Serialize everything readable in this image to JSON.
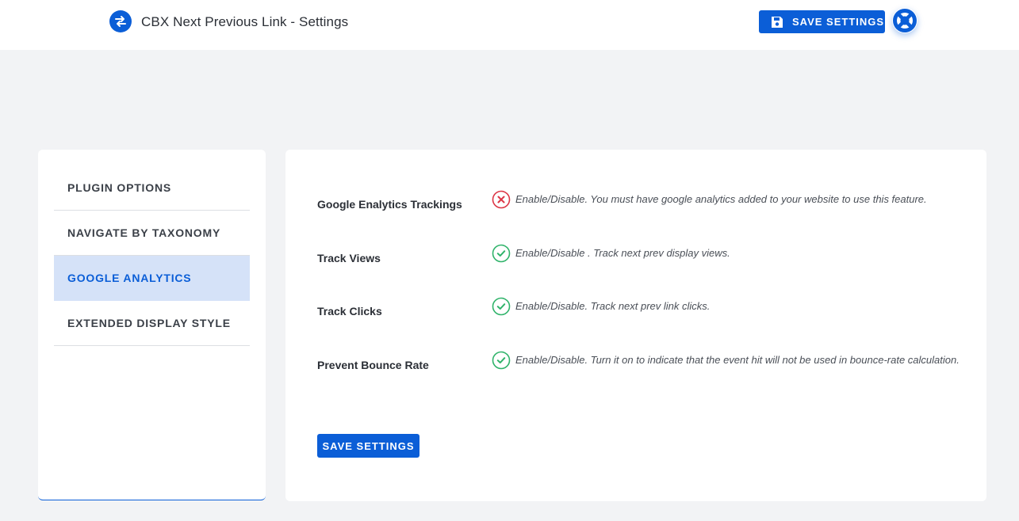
{
  "header": {
    "title": "CBX Next Previous Link - Settings",
    "save_label": "SAVE SETTINGS",
    "logo_icon": "swap-arrows-icon",
    "help_icon": "lifebuoy-icon"
  },
  "sidebar": {
    "items": [
      {
        "label": "PLUGIN OPTIONS",
        "active": false
      },
      {
        "label": "NAVIGATE BY TAXONOMY",
        "active": false
      },
      {
        "label": "GOOGLE ANALYTICS",
        "active": true
      },
      {
        "label": "EXTENDED DISPLAY STYLE",
        "active": false
      }
    ]
  },
  "settings": {
    "rows": [
      {
        "label": "Google Enalytics Trackings",
        "enabled": false,
        "description": "Enable/Disable. You must have google analytics added to your website to use this feature."
      },
      {
        "label": "Track Views",
        "enabled": true,
        "description": "Enable/Disable . Track next prev display views."
      },
      {
        "label": "Track Clicks",
        "enabled": true,
        "description": "Enable/Disable. Track next prev link clicks."
      },
      {
        "label": "Prevent Bounce Rate",
        "enabled": true,
        "description": "Enable/Disable. Turn it on to indicate that the event hit will not be used in bounce-rate calculation."
      }
    ],
    "save_label": "SAVE SETTINGS"
  },
  "colors": {
    "primary": "#0b5ed7",
    "enabled": "#2fb36a",
    "disabled": "#dc3545",
    "active_bg": "#d5e2f8"
  }
}
